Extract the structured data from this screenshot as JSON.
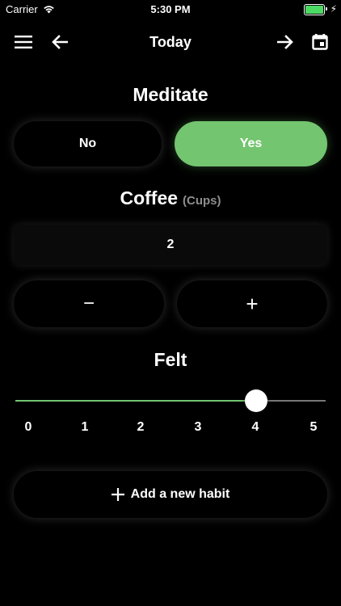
{
  "status_bar": {
    "carrier": "Carrier",
    "time": "5:30 PM",
    "battery_color": "#4cd964"
  },
  "nav": {
    "title": "Today",
    "icons": [
      "menu-icon",
      "arrow-left-icon",
      "arrow-right-icon",
      "calendar-icon"
    ]
  },
  "meditate": {
    "title": "Meditate",
    "no_label": "No",
    "yes_label": "Yes",
    "selected": "Yes",
    "accent": "#73c56f"
  },
  "coffee": {
    "title": "Coffee",
    "unit": "(Cups)",
    "value": "2",
    "decrement_label": "−",
    "increment_label": "+"
  },
  "felt": {
    "title": "Felt",
    "value": 4,
    "min": 0,
    "max": 5,
    "ticks": [
      "0",
      "1",
      "2",
      "3",
      "4",
      "5"
    ]
  },
  "add_habit": {
    "icon": "plus-icon",
    "label": "Add a new habit"
  }
}
